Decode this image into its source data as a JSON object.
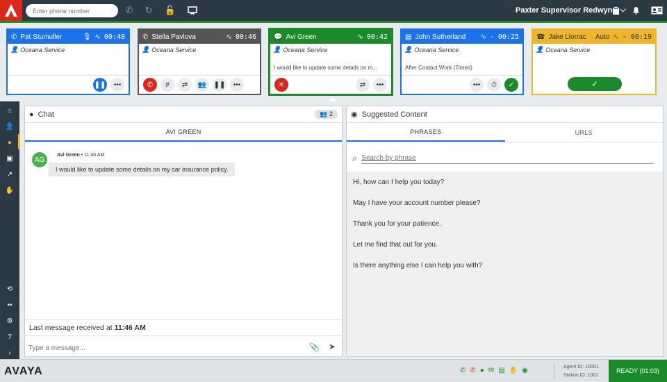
{
  "topbar": {
    "phone_placeholder": "Enter phone number",
    "user_name": "Paxter Supervisor Redwyne",
    "brand_color": "#da291c"
  },
  "cards": [
    {
      "name": "Pat Stumuller",
      "time": "00:48",
      "service": "Oceana Service",
      "message": ""
    },
    {
      "name": "Stella Pavlova",
      "time": "00:46",
      "service": "Oceana Service",
      "message": ""
    },
    {
      "name": "Avi Green",
      "time": "00:42",
      "service": "Oceana Service",
      "message": "I would like to update some details on m..."
    },
    {
      "name": "John Sutherland",
      "time": "- 00:25",
      "service": "Oceana Service",
      "message": "After Contact Work (Timed)"
    },
    {
      "name": "Jake Llorrac",
      "time": "- 00:19",
      "auto": "Auto",
      "service": "Oceana Service",
      "message": ""
    }
  ],
  "chat": {
    "title": "Chat",
    "participants": "2",
    "tab": "AVI GREEN",
    "avatar": "AG",
    "sender": "Avi Green",
    "timestamp": "11:46 AM",
    "message": "I would like to update some details on my car insurance policy.",
    "last_prefix": "Last message received at",
    "last_time": "11:46 AM",
    "input_placeholder": "Type a message..."
  },
  "suggested": {
    "title": "Suggested Content",
    "tabs": [
      "PHRASES",
      "URLS"
    ],
    "search_placeholder": "Search by phrase",
    "phrases": [
      "Hi, how can I help you today?",
      "May I have your account number please?",
      "Thank you for your patience.",
      "Let me find that out for you.",
      "Is there anything else I can help you with?"
    ]
  },
  "bottom": {
    "brand": "AVAYA",
    "agent_id": "Agent ID: 10001",
    "station_id": "Station ID: 1001",
    "status": "READY (01:03)"
  },
  "colors": {
    "blue": "#1a73e8",
    "green": "#1a8a2a",
    "amber": "#f0b429",
    "dark": "#2b3a45"
  }
}
